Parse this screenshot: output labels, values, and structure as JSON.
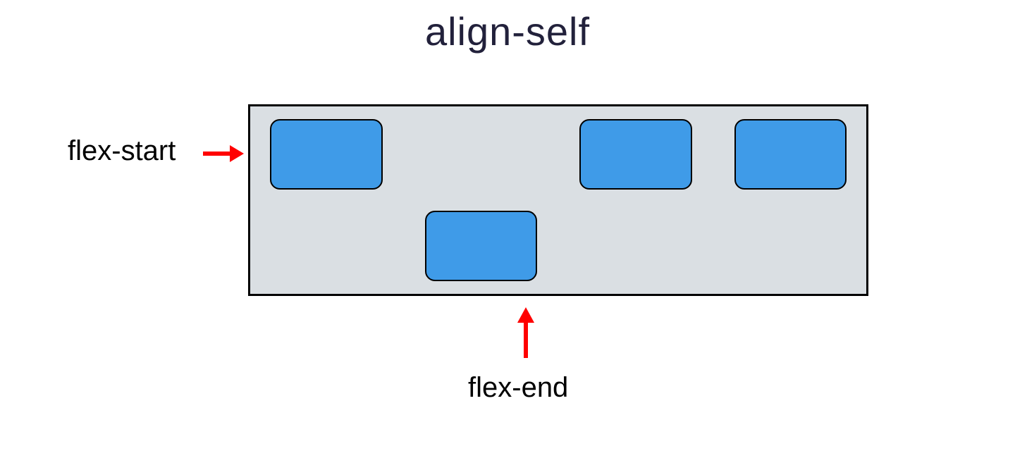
{
  "title": "align-self",
  "labels": {
    "flex_start": "flex-start",
    "flex_end": "flex-end"
  },
  "colors": {
    "box_fill": "#3f9be8",
    "container_fill": "#dadfe3",
    "arrow": "#ff0000",
    "title": "#22213b"
  },
  "layout": {
    "box_count": 4,
    "flex_end_index": 1,
    "property": "align-self",
    "values_demonstrated": [
      "flex-start",
      "flex-end"
    ]
  }
}
